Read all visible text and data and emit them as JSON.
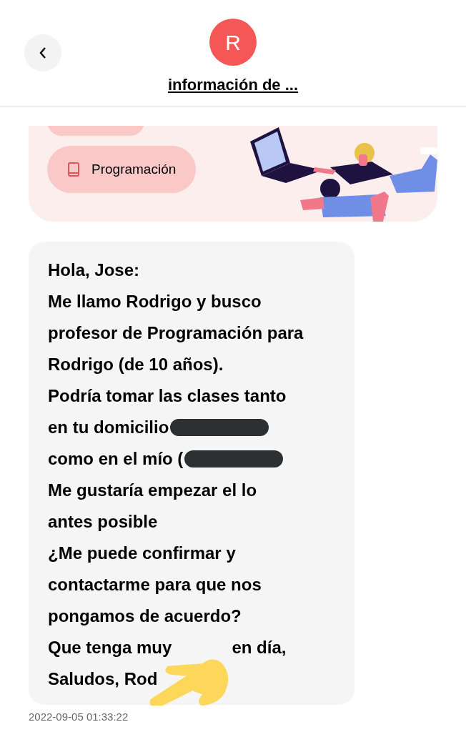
{
  "header": {
    "avatar_letter": "R",
    "title": "información de ..."
  },
  "subjects": [
    {
      "label": "Programación"
    }
  ],
  "message": {
    "lines": [
      {
        "text": "Hola, Jose:"
      },
      {
        "text": "Me llamo Rodrigo y busco"
      },
      {
        "text": "profesor de Programación para"
      },
      {
        "text": "Rodrigo  (de 10 años)."
      },
      {
        "text": "Podría tomar las clases tanto"
      },
      {
        "text": "en tu domicilio",
        "redacted": true
      },
      {
        "text": "como en el mío (",
        "redacted": true
      },
      {
        "text": "Me gustaría empezar el lo"
      },
      {
        "text": "antes posible"
      },
      {
        "text": "¿Me puede confirmar y"
      },
      {
        "text": "contactarme para que nos"
      },
      {
        "text": "pongamos de acuerdo?"
      },
      {
        "text": "Que tenga muy",
        "rest": "en día,"
      },
      {
        "text": "Saludos, Rod"
      }
    ],
    "timestamp": "2022-09-05 01:33:22"
  }
}
